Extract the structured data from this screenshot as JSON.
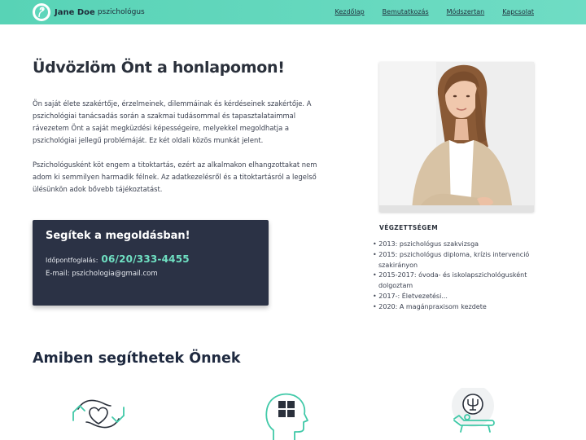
{
  "header": {
    "brand_name": "Jane Doe",
    "brand_sub": "pszichológus",
    "nav": [
      "Kezdőlap",
      "Bemutatkozás",
      "Módszertan",
      "Kapcsolat"
    ]
  },
  "hero": {
    "title": "Üdvözlöm Önt a honlapomon!",
    "paragraph1": "Ön saját élete szakértője, érzelmeinek, dilemmáinak és kérdéseinek szakértője. A pszichológiai tanácsadás során a szakmai tudásommal és tapasztalataimmal rávezetem Önt a saját megküzdési képességeire, melyekkel megoldhatja a pszichológiai jellegű problémáját. Ez két oldali közös munkát jelent.",
    "paragraph2": "Pszichológusként köt engem a titoktartás, ezért az alkalmakon elhangzottakat nem adom ki semmilyen harmadik félnek. Az adatkezelésről és a titoktartásról a legelső ülésünkön adok bővebb tájékoztatást."
  },
  "cta": {
    "title": "Segítek a megoldásban!",
    "booking_label": "Időpontfoglalás:",
    "phone": "06/20/333-4455",
    "email_line": "E-mail: pszichologia@gmail.com"
  },
  "education": {
    "title": "VÉGZETTSÉGEM",
    "items": [
      "2013: pszichológus szakvizsga",
      "2015: pszichológus diploma, krízis intervenció szakirányon",
      "2015-2017: óvoda- és iskolapszichológusként dolgoztam",
      "2017-: Életvezetési...",
      "2020: A magánpraxisom kezdete"
    ]
  },
  "services": {
    "title": "Amiben segíthetek Önnek",
    "icons": [
      "hands-heart-icon",
      "head-puzzle-icon",
      "psychology-couch-icon"
    ]
  },
  "colors": {
    "accent": "#5fd6bb",
    "dark_card": "#2b3245",
    "phone": "#6fe0c2"
  }
}
